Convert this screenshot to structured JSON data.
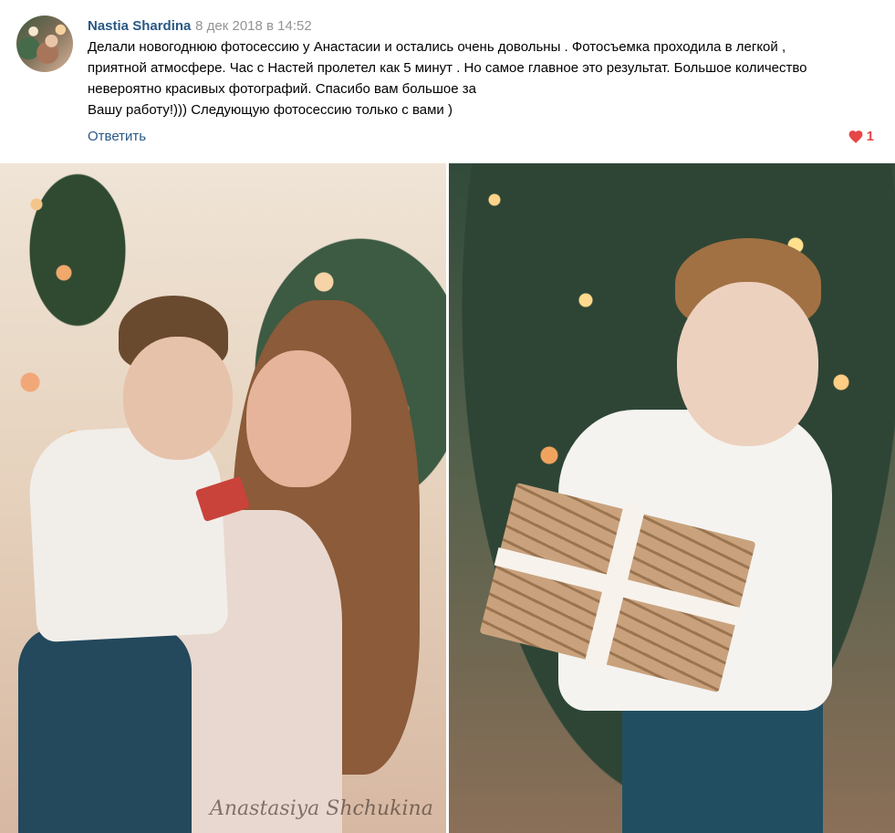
{
  "comment": {
    "author": "Nastia Shardina",
    "date": "8 дек 2018 в 14:52",
    "text_lines": [
      "Делали новогоднюю фотосессию у Анастасии и остались очень довольны . Фотосъемка проходила в легкой ,",
      "приятной атмосфере. Час с Настей пролетел как 5 минут . Но самое главное это результат. Большое количество",
      "невероятно красивых фотографий. Спасибо вам большое за",
      "Вашу работу!))) Следующую фотосессию только с вами )"
    ],
    "reply_label": "Ответить",
    "like_count": "1",
    "like_icon": "heart-icon",
    "accent_color": "#2a5885",
    "like_color": "#e64646"
  },
  "photos": [
    {
      "name": "photo-mother-and-son",
      "watermark": "Anastasiya Shchukina"
    },
    {
      "name": "photo-boy-with-gift"
    }
  ]
}
